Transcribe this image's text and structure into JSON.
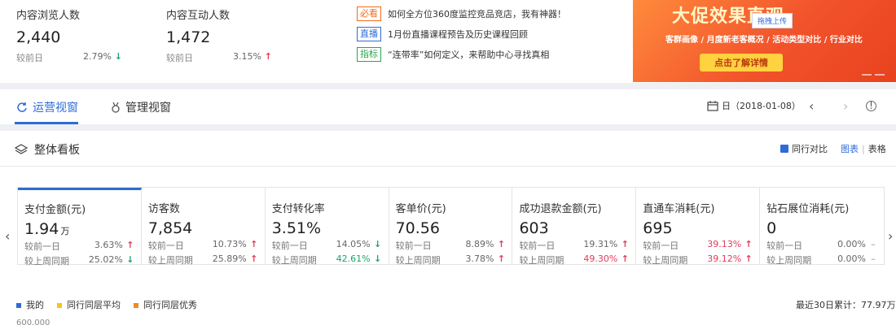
{
  "top_stats": [
    {
      "label": "内容浏览人数",
      "value": "2,440",
      "compare_label": "较前日",
      "compare_value": "2.79%",
      "trend": "down"
    },
    {
      "label": "内容互动人数",
      "value": "1,472",
      "compare_label": "较前日",
      "compare_value": "3.15%",
      "trend": "up"
    }
  ],
  "news": [
    {
      "tag": "必看",
      "color": "orange",
      "text": "如何全方位360度监控竞品竞店，我有神器！"
    },
    {
      "tag": "直播",
      "color": "blue",
      "text": "1月份直播课程预告及历史课程回顾"
    },
    {
      "tag": "指标",
      "color": "green",
      "text": "“连带率”如何定义，来帮助中心寻找真相"
    }
  ],
  "banner": {
    "headline": "大促效果直观",
    "subtitle": "客群画像 / 月度新老客概况 / 活动类型对比 / 行业对比",
    "cta": "点击了解详情",
    "upload": "拖拽上传"
  },
  "tabs": {
    "operations": "运营视窗",
    "management": "管理视窗",
    "date": "日（2018-01-08）"
  },
  "panel": {
    "title": "整体看板",
    "peer_compare": "同行对比",
    "view_chart": "图表",
    "separator": "|",
    "view_table": "表格"
  },
  "cards": [
    {
      "title": "支付金额(元)",
      "value": "1.94",
      "unit": "万",
      "rows": [
        {
          "label": "较前一日",
          "value": "3.63%",
          "trend": "up"
        },
        {
          "label": "较上周同期",
          "value": "25.02%",
          "trend": "down"
        }
      ]
    },
    {
      "title": "访客数",
      "value": "7,854",
      "unit": "",
      "rows": [
        {
          "label": "较前一日",
          "value": "10.73%",
          "trend": "up"
        },
        {
          "label": "较上周同期",
          "value": "25.89%",
          "trend": "up"
        }
      ]
    },
    {
      "title": "支付转化率",
      "value": "3.51%",
      "unit": "",
      "rows": [
        {
          "label": "较前一日",
          "value": "14.05%",
          "trend": "down"
        },
        {
          "label": "较上周同期",
          "value": "42.61%",
          "trend": "down",
          "highlight": "green"
        }
      ]
    },
    {
      "title": "客单价(元)",
      "value": "70.56",
      "unit": "",
      "rows": [
        {
          "label": "较前一日",
          "value": "8.89%",
          "trend": "up"
        },
        {
          "label": "较上周同期",
          "value": "3.78%",
          "trend": "up"
        }
      ]
    },
    {
      "title": "成功退款金额(元)",
      "value": "603",
      "unit": "",
      "rows": [
        {
          "label": "较前一日",
          "value": "19.31%",
          "trend": "up"
        },
        {
          "label": "较上周同期",
          "value": "49.30%",
          "trend": "up",
          "highlight": "red"
        }
      ]
    },
    {
      "title": "直通车消耗(元)",
      "value": "695",
      "unit": "",
      "rows": [
        {
          "label": "较前一日",
          "value": "39.13%",
          "trend": "up",
          "highlight": "red"
        },
        {
          "label": "较上周同期",
          "value": "39.12%",
          "trend": "up",
          "highlight": "red"
        }
      ]
    },
    {
      "title": "钻石展位消耗(元)",
      "value": "0",
      "unit": "",
      "rows": [
        {
          "label": "较前一日",
          "value": "0.00%",
          "trend": "flat"
        },
        {
          "label": "较上周同期",
          "value": "0.00%",
          "trend": "flat"
        }
      ]
    }
  ],
  "legend": [
    {
      "label": "我的",
      "color": "#2f6bd8"
    },
    {
      "label": "同行同层平均",
      "color": "#f5c518"
    },
    {
      "label": "同行同层优秀",
      "color": "#f08a24"
    }
  ],
  "total": "最近30日累计：77.97万",
  "y_axis_top": "600,000"
}
